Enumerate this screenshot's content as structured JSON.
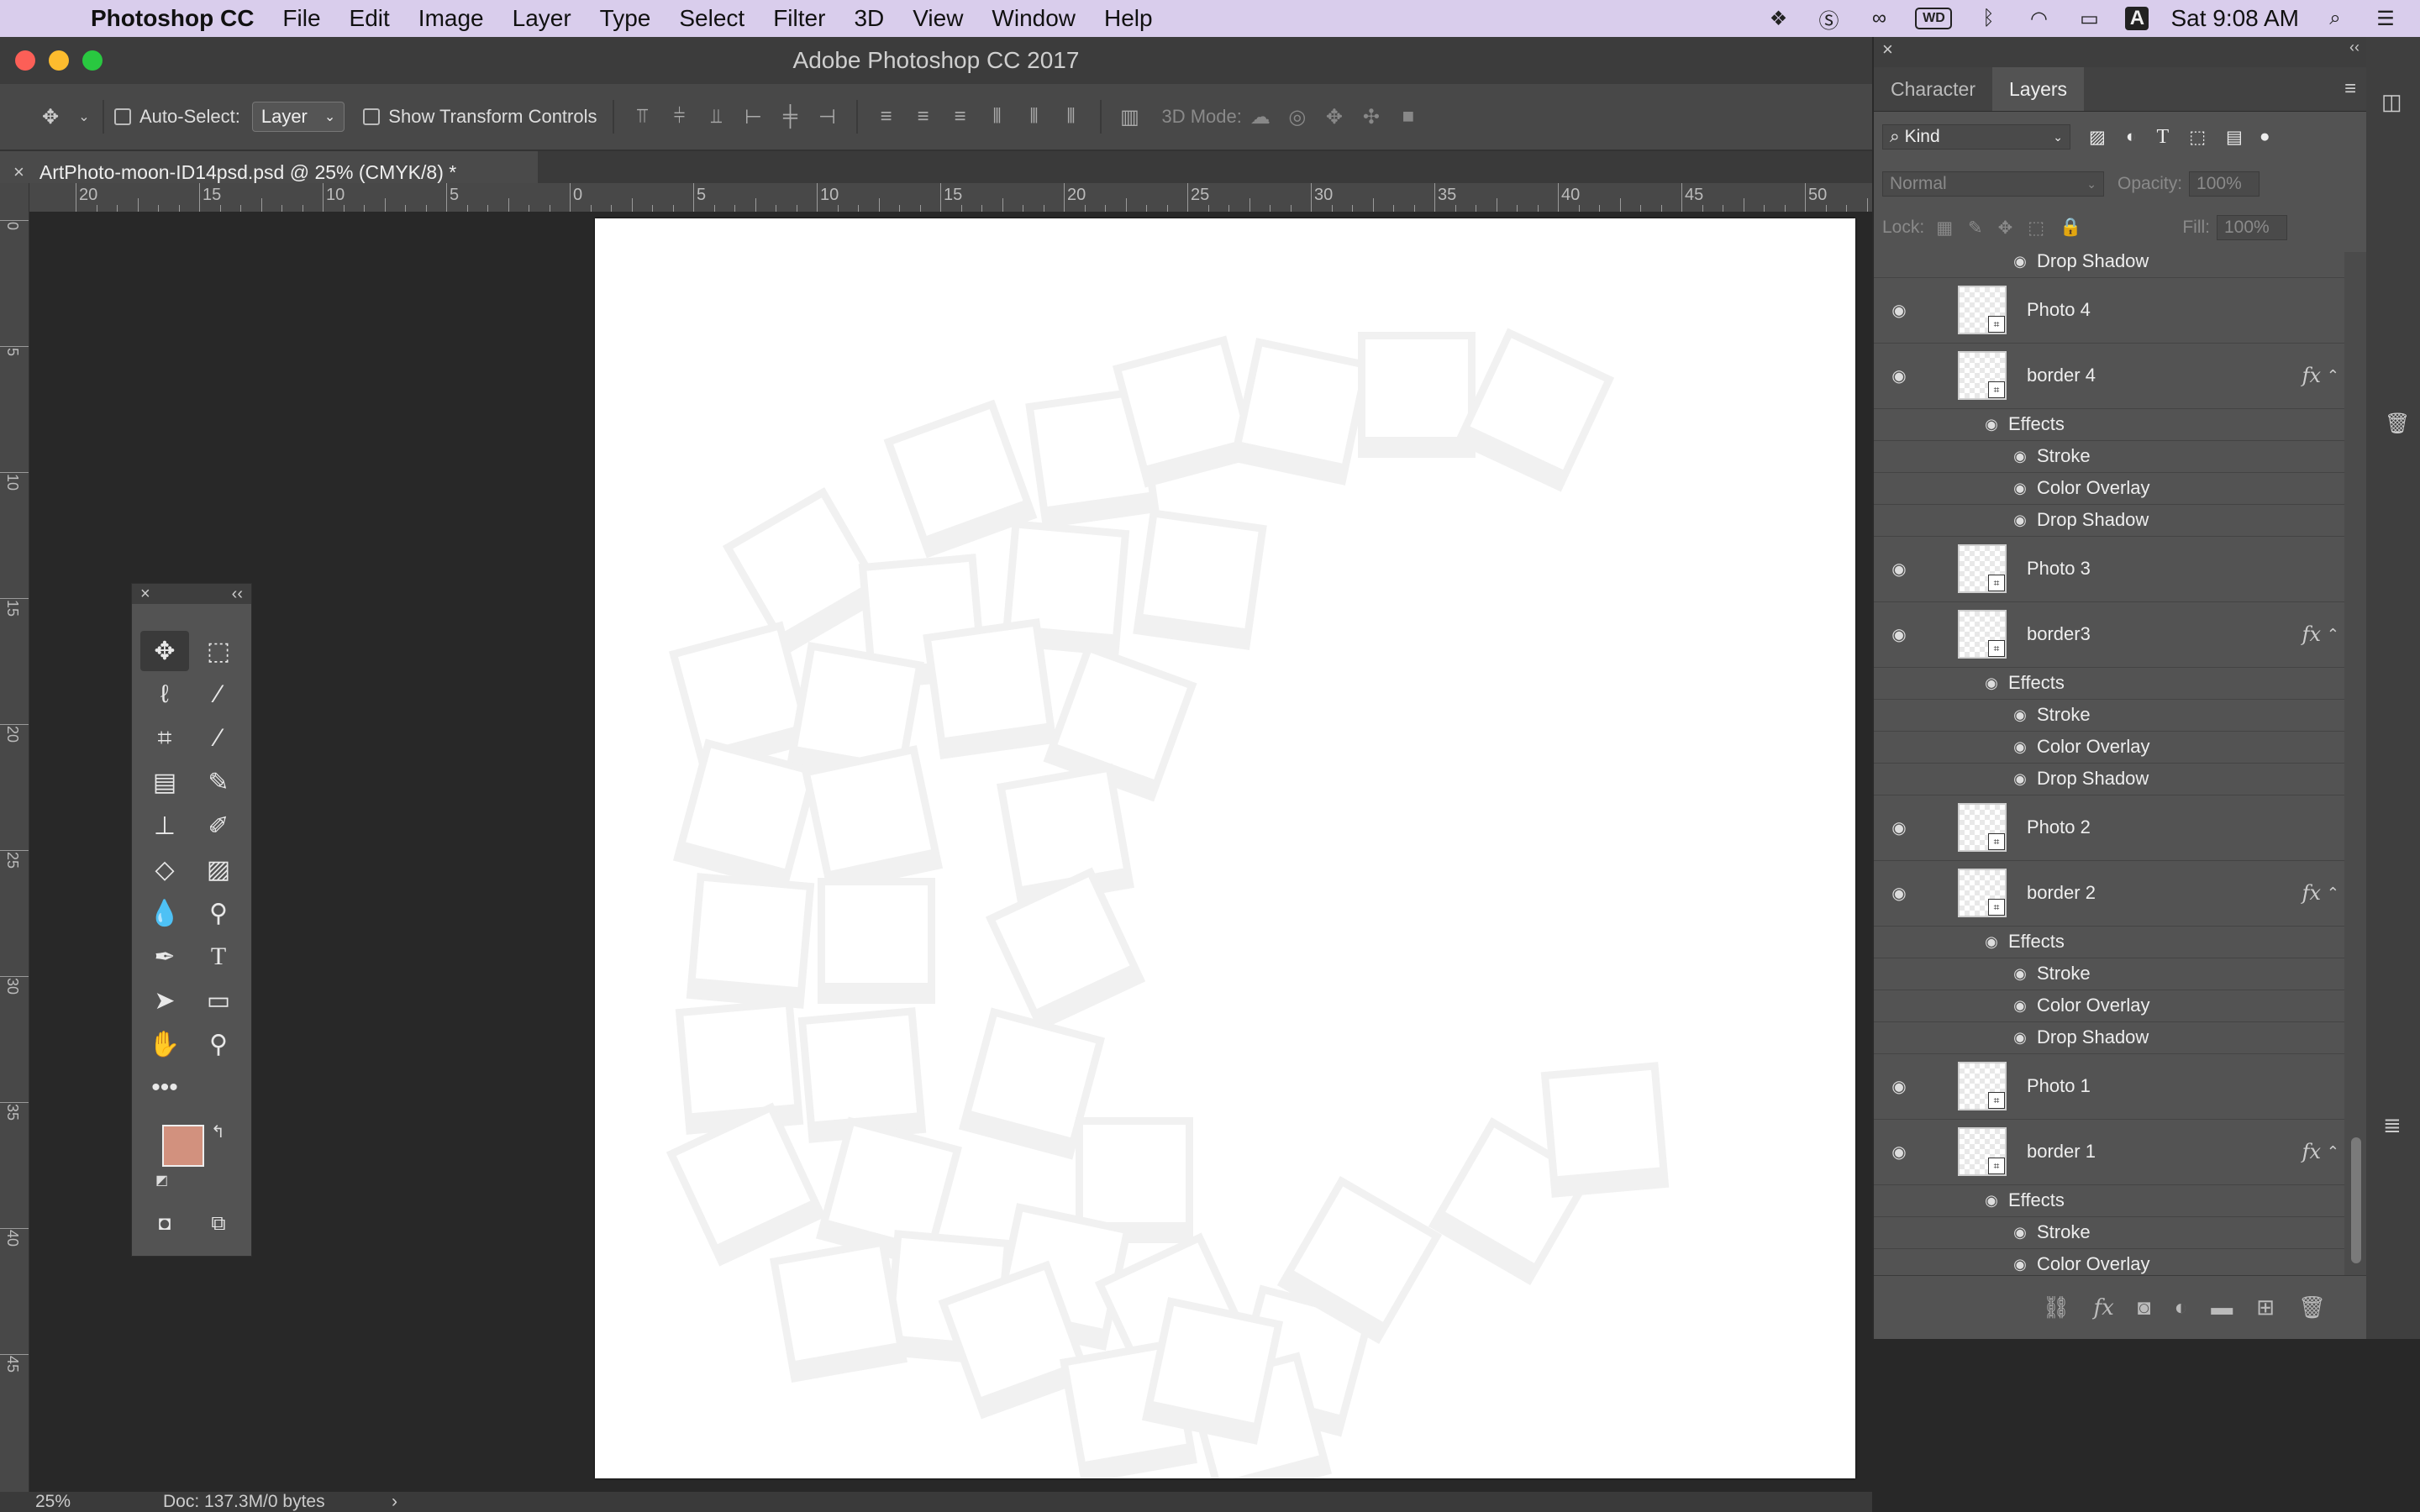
{
  "menubar": {
    "app_name": "Photoshop CC",
    "items": [
      "File",
      "Edit",
      "Image",
      "Layer",
      "Type",
      "Select",
      "Filter",
      "3D",
      "View",
      "Window",
      "Help"
    ],
    "clock": "Sat 9:08 AM"
  },
  "window": {
    "title": "Adobe Photoshop CC 2017"
  },
  "options": {
    "auto_select_label": "Auto-Select:",
    "auto_select_value": "Layer",
    "show_transform_label": "Show Transform Controls",
    "mode_3d_label": "3D Mode:"
  },
  "document": {
    "tab_title": "ArtPhoto-moon-ID14psd.psd @ 25% (CMYK/8) *"
  },
  "ruler": {
    "h_labels": [
      "20",
      "15",
      "10",
      "5",
      "0",
      "5",
      "10",
      "15",
      "20",
      "25",
      "30",
      "35",
      "40",
      "45",
      "50"
    ],
    "v_labels": [
      "0",
      "5",
      "10",
      "15",
      "20",
      "25",
      "30",
      "35",
      "40",
      "45"
    ]
  },
  "status": {
    "zoom": "25%",
    "doc_info": "Doc: 137.3M/0 bytes"
  },
  "tools": {
    "foreground_color": "#d2917e",
    "background_color": "#ffffff",
    "items": [
      "move-tool",
      "marquee-tool",
      "lasso-tool",
      "magic-wand-tool",
      "crop-tool",
      "eyedropper-tool",
      "healing-brush-tool",
      "brush-tool",
      "clone-stamp-tool",
      "history-brush-tool",
      "eraser-tool",
      "gradient-tool",
      "blur-tool",
      "dodge-tool",
      "pen-tool",
      "type-tool",
      "path-selection-tool",
      "rectangle-tool",
      "hand-tool",
      "zoom-tool"
    ]
  },
  "panel": {
    "tabs": [
      "Character",
      "Layers"
    ],
    "active_tab": "Layers",
    "filter_kind": "Kind",
    "blend_mode": "Normal",
    "opacity_label": "Opacity:",
    "opacity_value": "100%",
    "lock_label": "Lock:",
    "fill_label": "Fill:",
    "fill_value": "100%",
    "fx_label": "fx"
  },
  "layers": [
    {
      "type": "effect",
      "name": "Drop Shadow"
    },
    {
      "type": "layer",
      "name": "Photo 4",
      "fx": false
    },
    {
      "type": "layer",
      "name": "border 4",
      "fx": true
    },
    {
      "type": "effects",
      "name": "Effects"
    },
    {
      "type": "effect",
      "name": "Stroke"
    },
    {
      "type": "effect",
      "name": "Color Overlay"
    },
    {
      "type": "effect",
      "name": "Drop Shadow"
    },
    {
      "type": "layer",
      "name": "Photo 3",
      "fx": false
    },
    {
      "type": "layer",
      "name": "border3",
      "fx": true
    },
    {
      "type": "effects",
      "name": "Effects"
    },
    {
      "type": "effect",
      "name": "Stroke"
    },
    {
      "type": "effect",
      "name": "Color Overlay"
    },
    {
      "type": "effect",
      "name": "Drop Shadow"
    },
    {
      "type": "layer",
      "name": "Photo 2",
      "fx": false
    },
    {
      "type": "layer",
      "name": "border 2",
      "fx": true
    },
    {
      "type": "effects",
      "name": "Effects"
    },
    {
      "type": "effect",
      "name": "Stroke"
    },
    {
      "type": "effect",
      "name": "Color Overlay"
    },
    {
      "type": "effect",
      "name": "Drop Shadow"
    },
    {
      "type": "layer",
      "name": "Photo 1",
      "fx": false
    },
    {
      "type": "layer",
      "name": "border 1",
      "fx": true
    },
    {
      "type": "effects",
      "name": "Effects"
    },
    {
      "type": "effect",
      "name": "Stroke"
    },
    {
      "type": "effect",
      "name": "Color Overlay"
    }
  ]
}
